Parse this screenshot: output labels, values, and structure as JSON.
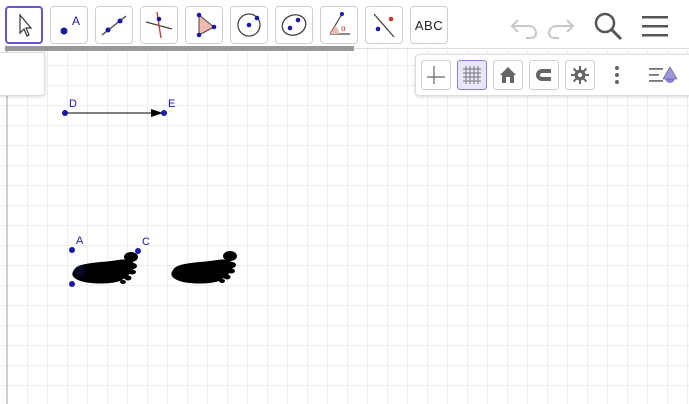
{
  "toolbar": {
    "tools": [
      {
        "name": "move",
        "icon": "arrow-cursor-icon"
      },
      {
        "name": "point",
        "icon": "point-icon",
        "letter": "A"
      },
      {
        "name": "line",
        "icon": "line-icon"
      },
      {
        "name": "perpendicular",
        "icon": "perpendicular-line-icon"
      },
      {
        "name": "polygon",
        "icon": "polygon-icon"
      },
      {
        "name": "circle",
        "icon": "circle-icon"
      },
      {
        "name": "ellipse",
        "icon": "ellipse-icon"
      },
      {
        "name": "angle",
        "icon": "angle-icon",
        "symbol": "α"
      },
      {
        "name": "reflect",
        "icon": "reflect-icon"
      },
      {
        "name": "text",
        "icon": "text-icon",
        "label": "ABC"
      }
    ],
    "selected": "move"
  },
  "header": {
    "undo_icon": "undo-icon",
    "redo_icon": "redo-icon",
    "search_icon": "search-icon",
    "menu_icon": "hamburger-menu-icon"
  },
  "style_bar": {
    "buttons": [
      "axes-icon",
      "grid-icon",
      "home-icon",
      "magnet-icon",
      "gear-icon",
      "more-vertical-icon",
      "view-toggle-icon"
    ],
    "grid_active": true
  },
  "graphics": {
    "points": {
      "D": "D",
      "E": "E",
      "A": "A",
      "C": "C"
    },
    "objects": [
      "vector-DE",
      "footprint-1",
      "footprint-2"
    ]
  },
  "colors": {
    "accent": "#6557d2",
    "point": "#1a1aa6",
    "grid": "#d9d9d9"
  }
}
